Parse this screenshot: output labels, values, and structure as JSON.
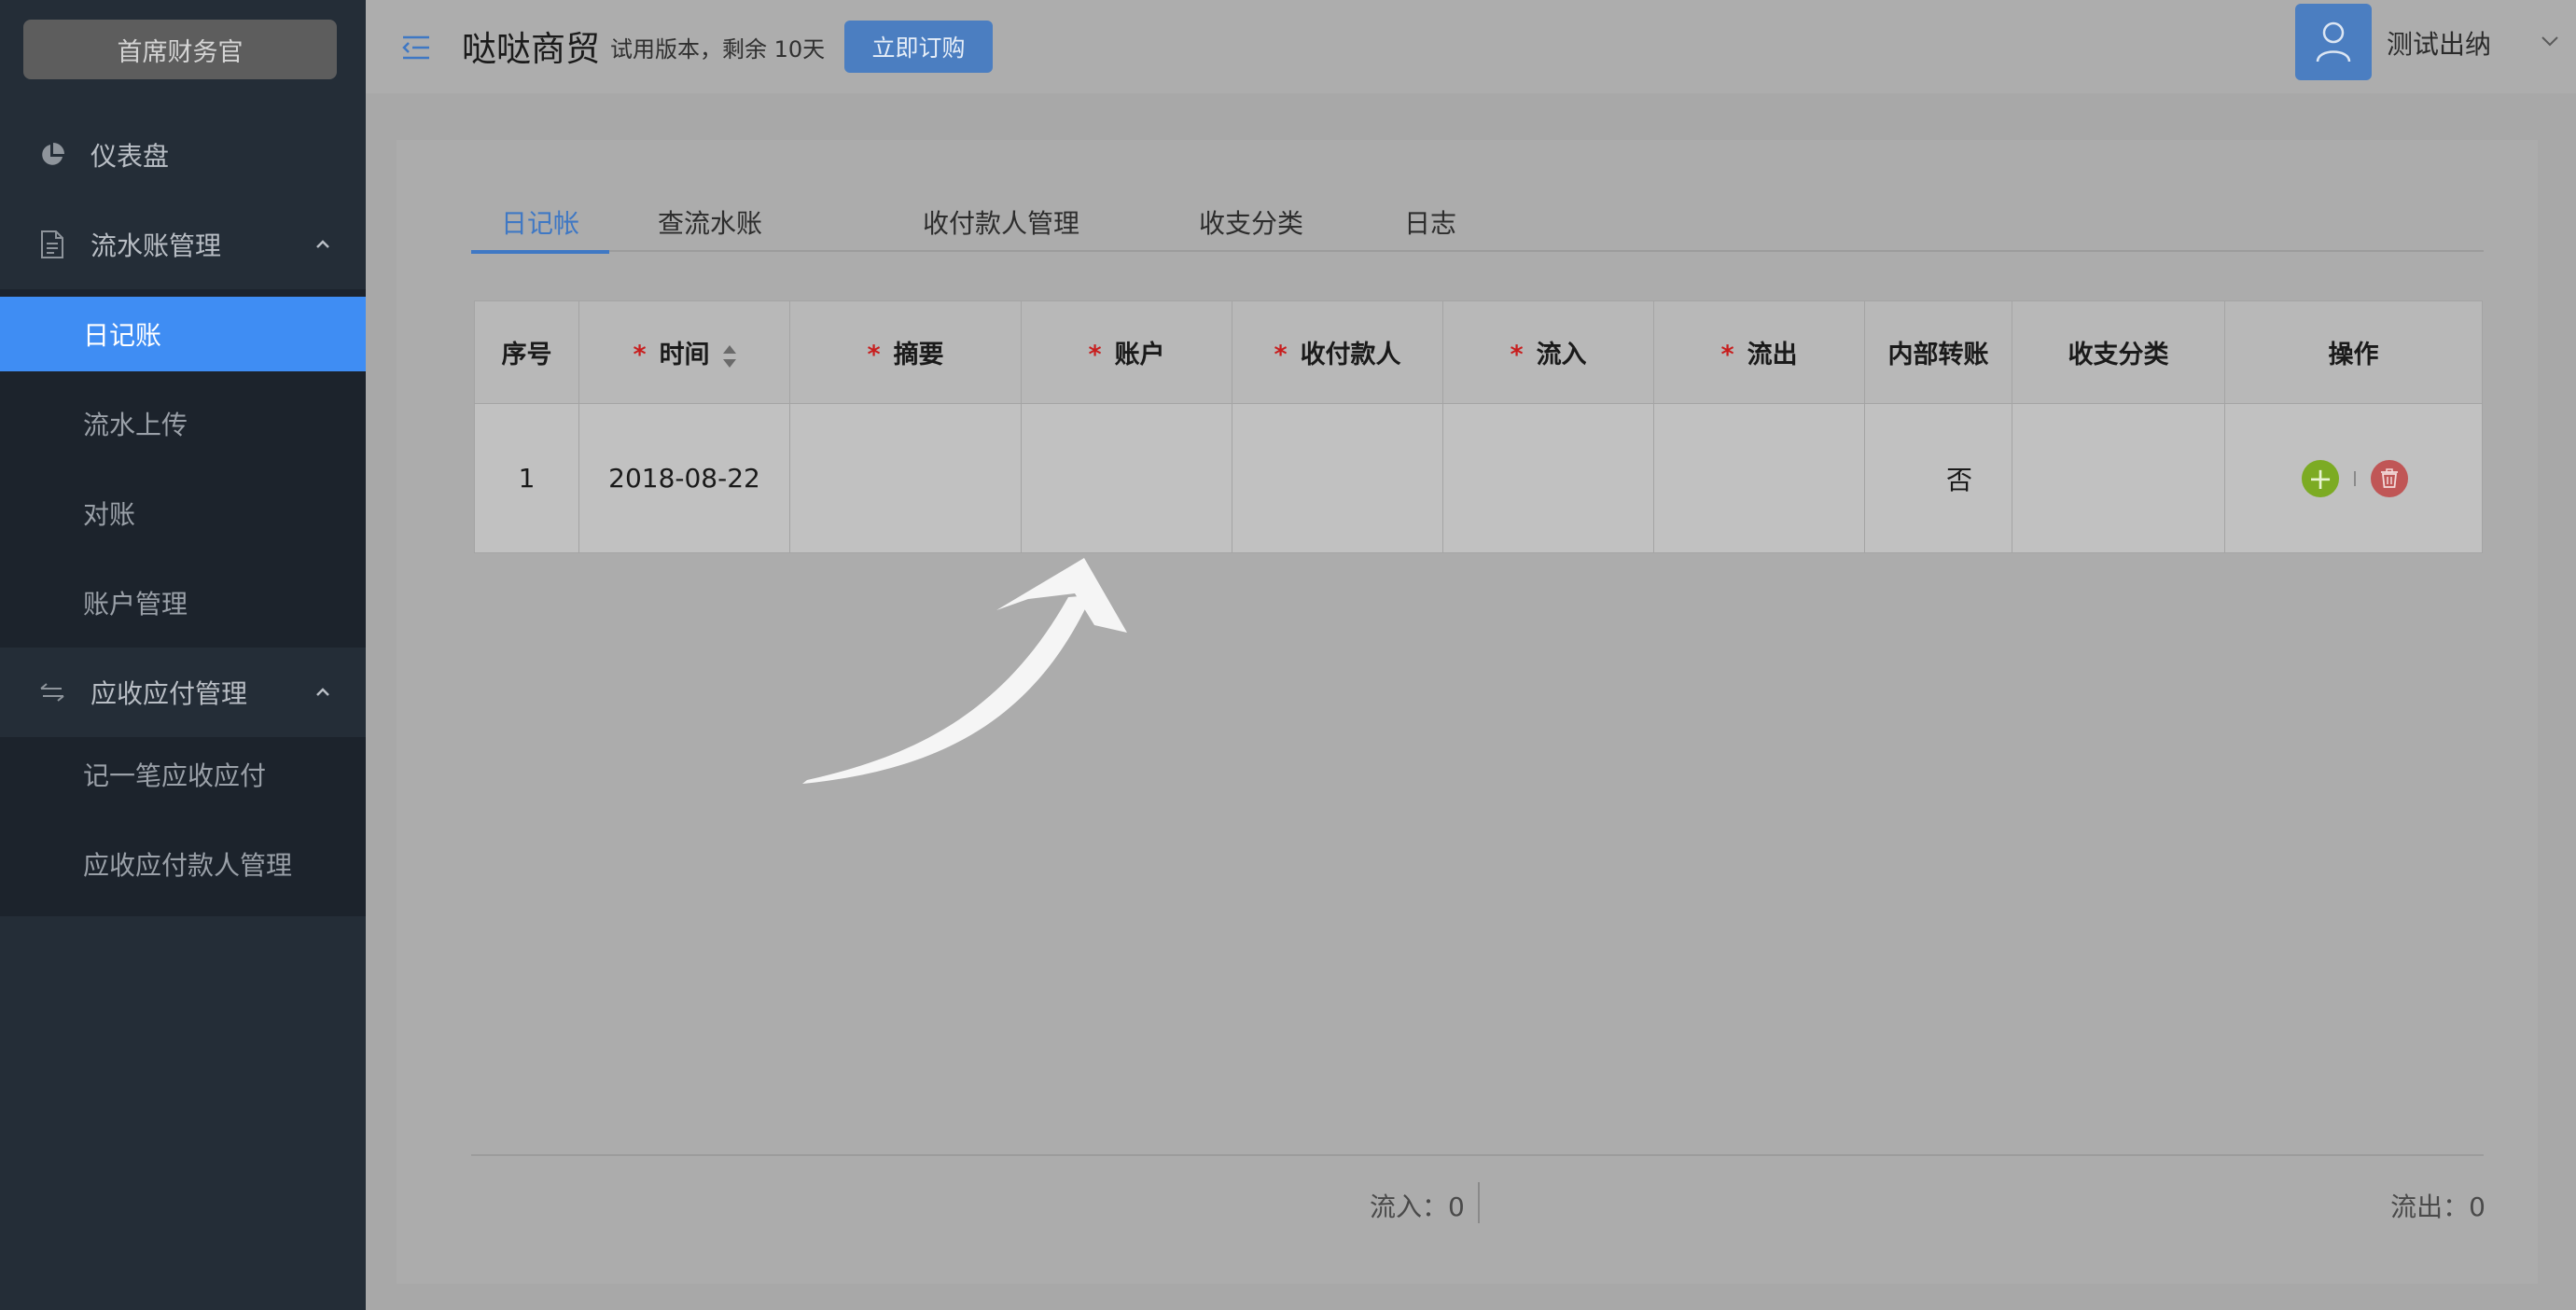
{
  "sidebar": {
    "brand": "首席财务官",
    "dashboard": "仪表盘",
    "group_ledger": {
      "label": "流水账管理",
      "items": [
        "日记账",
        "流水上传",
        "对账",
        "账户管理"
      ],
      "active_index": 0
    },
    "group_ar_ap": {
      "label": "应收应付管理",
      "items": [
        "记一笔应收应付",
        "应收应付款人管理"
      ]
    }
  },
  "header": {
    "company": "哒哒商贸",
    "trial_notice": "试用版本，剩余 10天",
    "buy_button": "立即订购",
    "user_name": "测试出纳"
  },
  "tabs": [
    "日记帐",
    "查流水账",
    "收付款人管理",
    "收支分类",
    "日志"
  ],
  "active_tab": 0,
  "table": {
    "columns": {
      "seq": "序号",
      "time": "时间",
      "summary": "摘要",
      "account": "账户",
      "payee": "收付款人",
      "inflow": "流入",
      "outflow": "流出",
      "internal": "内部转账",
      "category": "收支分类",
      "ops": "操作"
    },
    "required_mark": "*",
    "rows": [
      {
        "seq": "1",
        "time": "2018-08-22",
        "summary": "",
        "account": "",
        "payee": "",
        "inflow": "",
        "outflow": "",
        "internal": "否",
        "category": ""
      }
    ]
  },
  "footer": {
    "inflow": "流入：0",
    "outflow": "流出：0"
  },
  "colors": {
    "sidebar_bg": "#242d37",
    "active_item": "#3f8df3",
    "accent": "#3f78c4",
    "add_icon": "#7cab23",
    "delete_icon": "#c05656",
    "required": "#c81e1e"
  },
  "icons": [
    "pie-chart-icon",
    "document-icon",
    "exchange-icon",
    "chevron-up-icon",
    "menu-toggle-icon",
    "user-icon",
    "chevron-down-icon",
    "sort-icon",
    "plus-icon",
    "trash-icon",
    "curved-arrow"
  ]
}
